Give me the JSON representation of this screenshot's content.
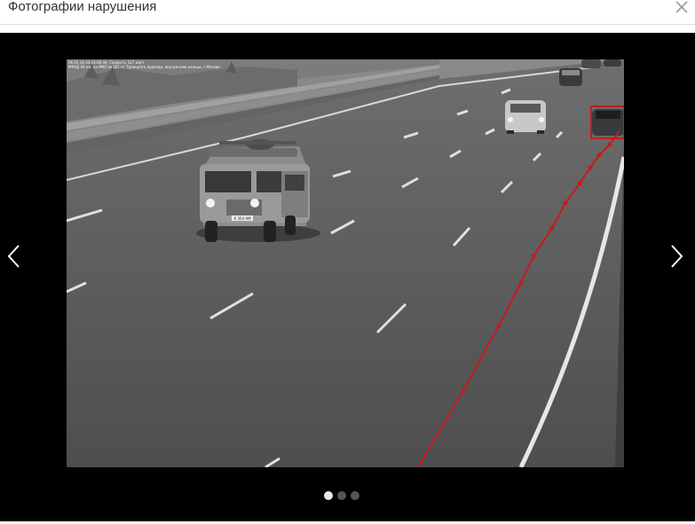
{
  "dialog": {
    "title": "Фотографии нарушения"
  },
  "photo": {
    "stamp_line1": "06.03.14 04:16:08.04, Скорость 127 км/ч",
    "stamp_line2": "МКАД 49 км, на МКО № 261 от Троицкого проезда, внутренняя кольцо, г.Москва",
    "plate_text": "Х 354 АМ",
    "track_color": "#c8191e"
  },
  "carousel": {
    "slides_count": 3,
    "active_index": 0
  },
  "icons": {
    "close": "close-icon",
    "prev": "chevron-left-icon",
    "next": "chevron-right-icon"
  }
}
